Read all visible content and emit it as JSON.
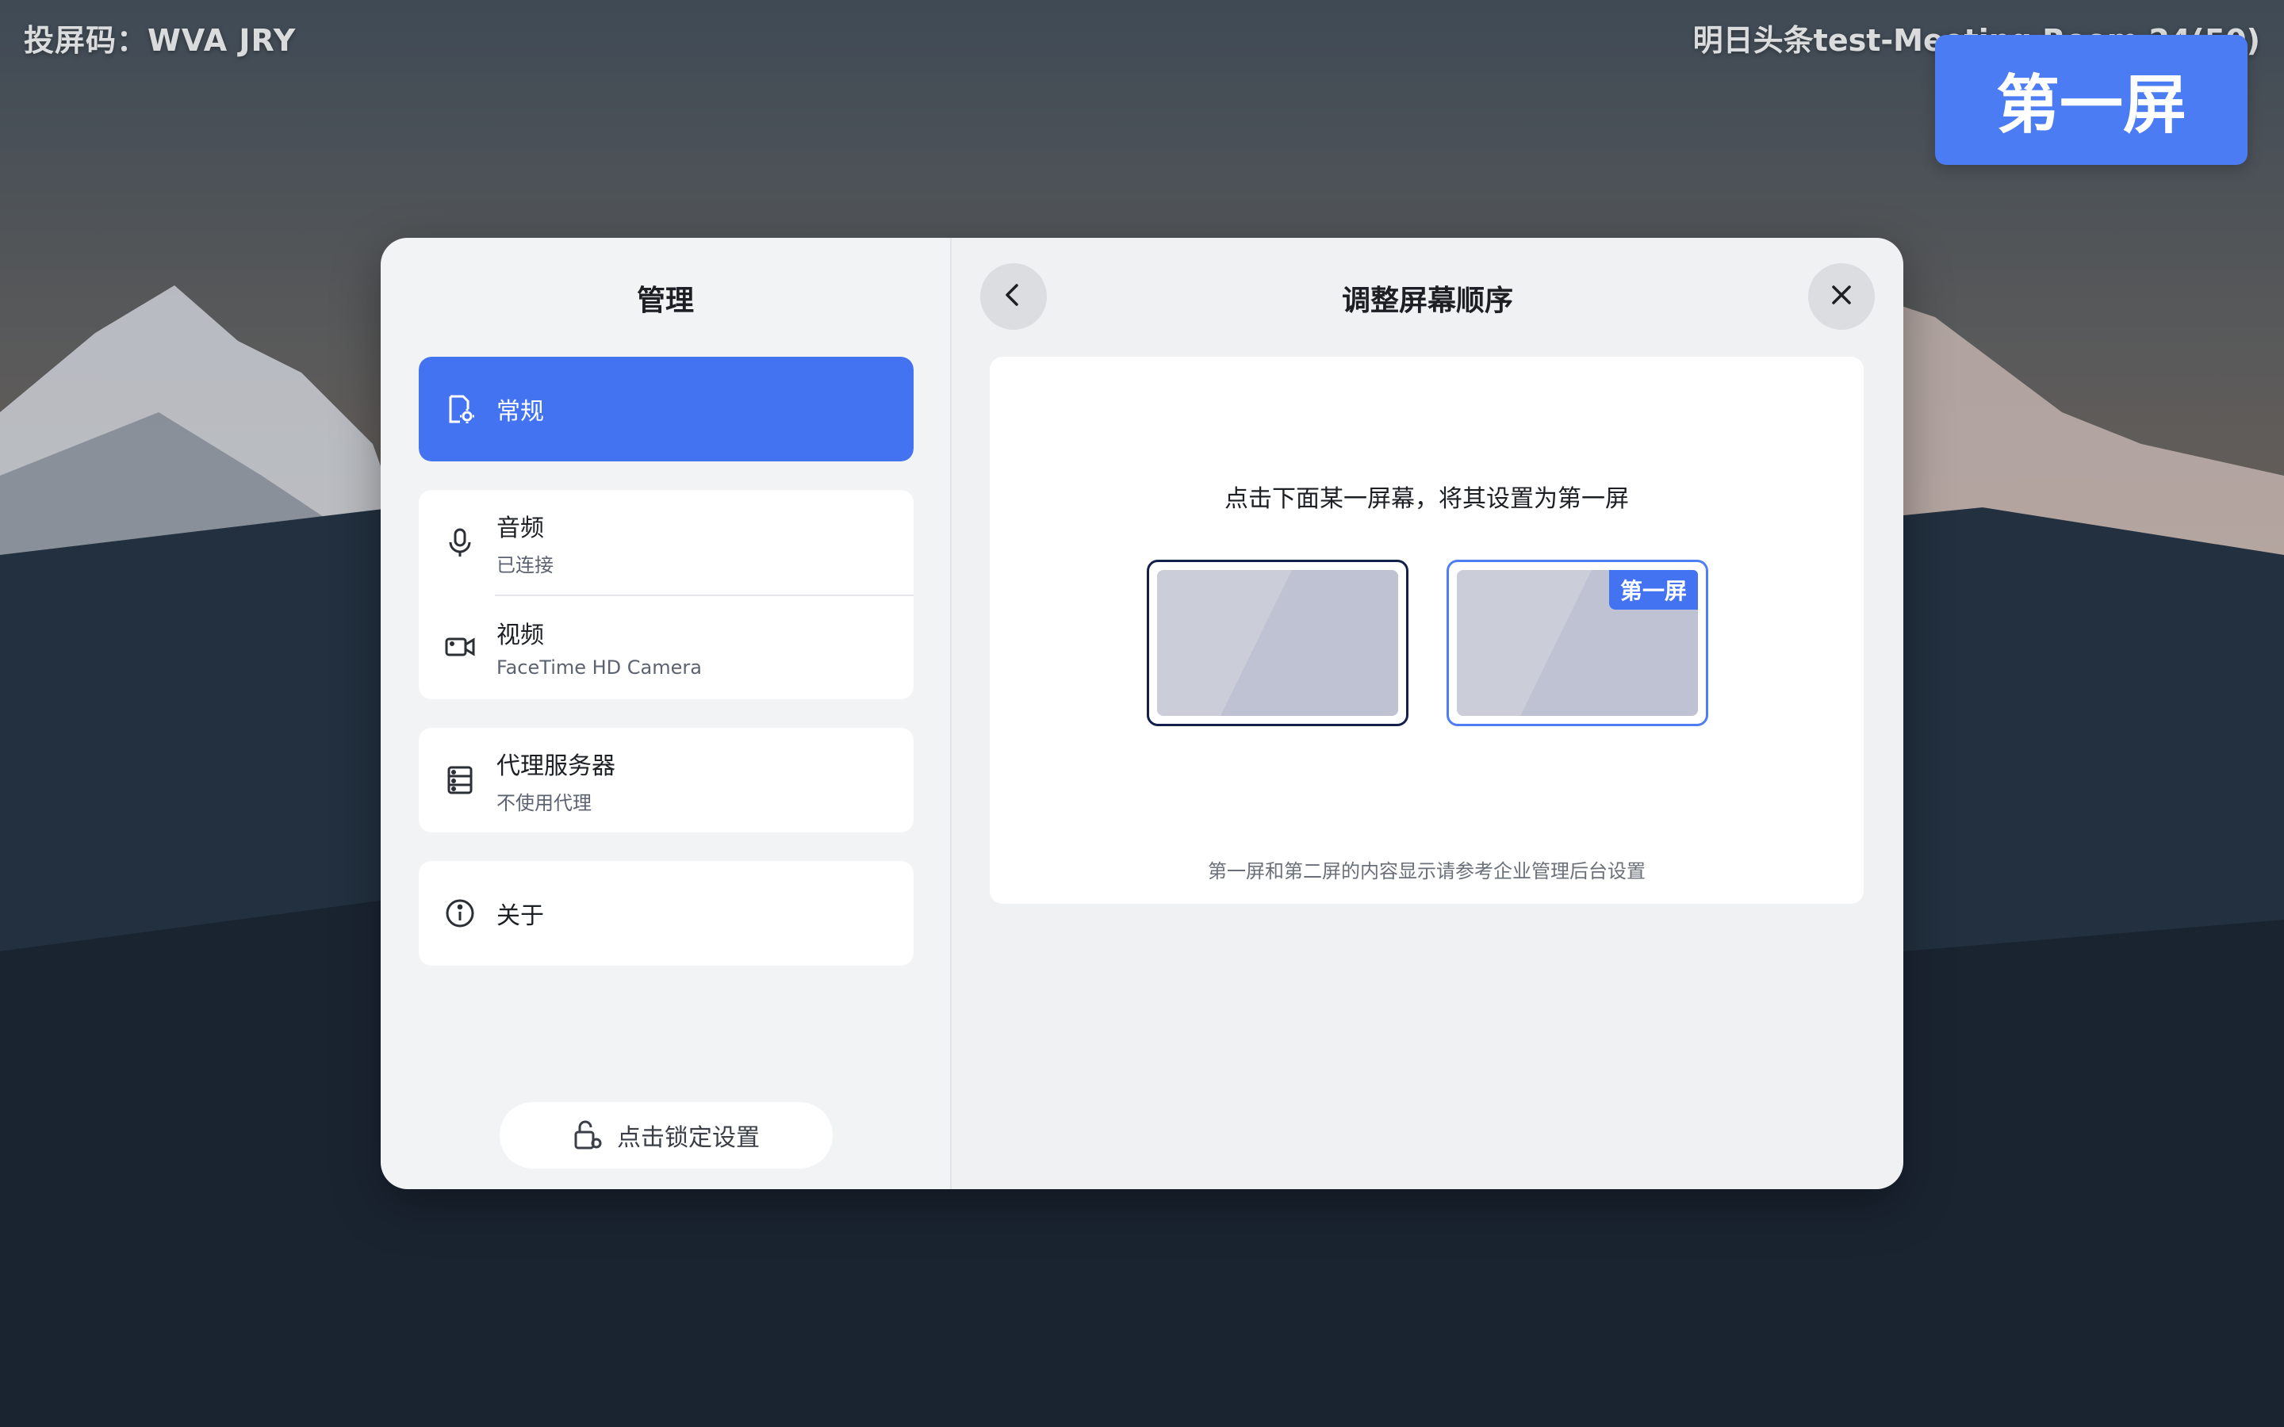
{
  "topbar": {
    "cast_code": "投屏码：WVA JRY",
    "room_name": "明日头条test-Meeting Room 24(50)"
  },
  "screen_badge": "第一屏",
  "sidebar": {
    "title": "管理",
    "items": [
      {
        "label": "常规",
        "sub": "",
        "icon": "settings-doc-icon",
        "active": true
      },
      {
        "label": "音频",
        "sub": "已连接",
        "icon": "microphone-icon"
      },
      {
        "label": "视频",
        "sub": "FaceTime HD Camera",
        "icon": "camera-icon"
      },
      {
        "label": "代理服务器",
        "sub": "不使用代理",
        "icon": "server-icon"
      },
      {
        "label": "关于",
        "sub": "",
        "icon": "info-icon"
      }
    ],
    "lock_button": "点击锁定设置"
  },
  "main": {
    "title": "调整屏幕顺序",
    "instruction": "点击下面某一屏幕，将其设置为第一屏",
    "screens": [
      {
        "tag": ""
      },
      {
        "tag": "第一屏"
      }
    ],
    "footnote": "第一屏和第二屏的内容显示请参考企业管理后台设置"
  },
  "colors": {
    "accent": "#4473f2",
    "badge": "#4b7cf3",
    "selected_border": "#13204a"
  }
}
